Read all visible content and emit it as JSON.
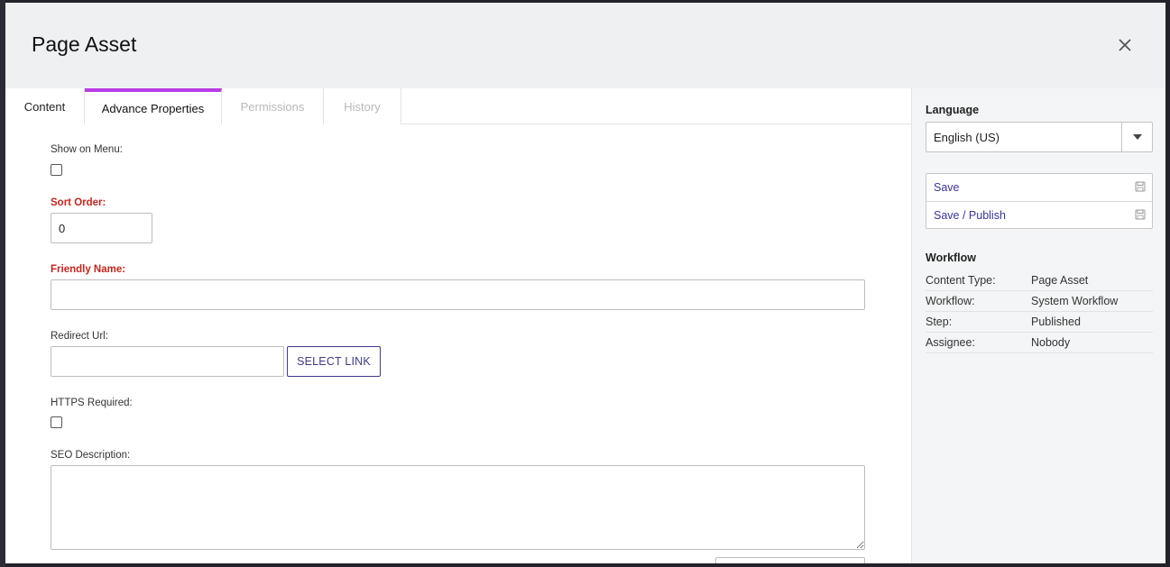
{
  "dialog": {
    "title": "Page Asset",
    "close_icon": "close-icon"
  },
  "tabs": [
    {
      "label": "Content",
      "state": "normal"
    },
    {
      "label": "Advance Properties",
      "state": "active"
    },
    {
      "label": "Permissions",
      "state": "disabled"
    },
    {
      "label": "History",
      "state": "disabled"
    }
  ],
  "form": {
    "show_on_menu": {
      "label": "Show on Menu:",
      "checked": false
    },
    "sort_order": {
      "label": "Sort Order:",
      "value": "0"
    },
    "friendly_name": {
      "label": "Friendly Name:",
      "value": ""
    },
    "redirect_url": {
      "label": "Redirect Url:",
      "value": "",
      "button": "SELECT LINK"
    },
    "https_required": {
      "label": "HTTPS Required:",
      "checked": false
    },
    "seo_description": {
      "label": "SEO Description:",
      "value": ""
    }
  },
  "sidebar": {
    "language": {
      "title": "Language",
      "selected": "English (US)"
    },
    "actions": [
      {
        "label": "Save",
        "icon": "save-icon"
      },
      {
        "label": "Save / Publish",
        "icon": "save-icon"
      }
    ],
    "workflow": {
      "title": "Workflow",
      "rows": [
        {
          "key": "Content Type:",
          "value": "Page Asset"
        },
        {
          "key": "Workflow:",
          "value": "System Workflow"
        },
        {
          "key": "Step:",
          "value": "Published"
        },
        {
          "key": "Assignee:",
          "value": "Nobody"
        }
      ]
    }
  },
  "colors": {
    "accent_tab": "#b93ce6",
    "required_label": "#c4261d",
    "link": "#3a3499"
  }
}
